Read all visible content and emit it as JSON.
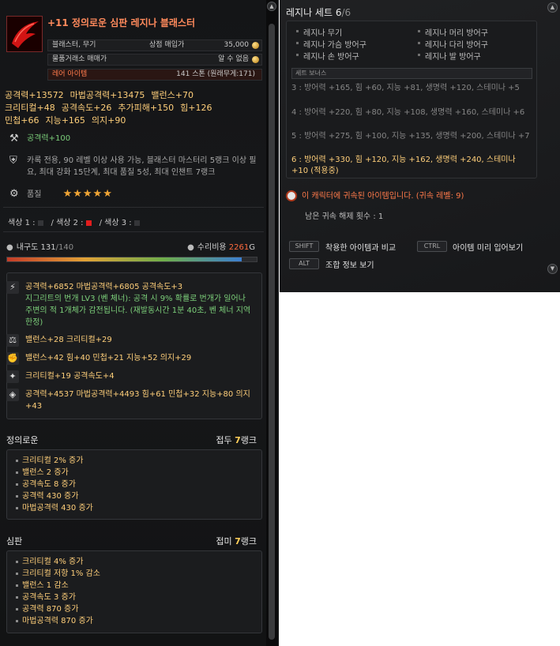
{
  "item": {
    "title": "+11 정의로운 심판 레지나 블래스터",
    "rows": [
      {
        "label": "블래스터, 무기",
        "mid": "상점 매입가",
        "value": "35,000"
      },
      {
        "label": "물품거래소 매매가",
        "mid": "",
        "value": "알 수 없음"
      },
      {
        "label": "레어 아이템",
        "mid": "",
        "value": "141 스톤 (원래무게:171)"
      }
    ]
  },
  "base_stats": {
    "line1": [
      "공격력+13572",
      "마법공격력+13475",
      "밸런스+70"
    ],
    "line2": [
      "크리티컬+48",
      "공격속도+26",
      "추가피해+150",
      "힘+126"
    ],
    "line3": [
      "민첩+66",
      "지능+165",
      "의지+90"
    ]
  },
  "attack_line": "공격력+100",
  "requirement": "카록 전용, 90 레벨 이상 사용 가능, 블래스터 마스터리 5랭크 이상 필요, 최대 강화 15단계, 최대 품질 5성, 최대 인챈트 7랭크",
  "quality": {
    "label": "품질",
    "stars": "★★★★★"
  },
  "colors": {
    "c1": "색상 1 :",
    "c2": "색상 2 :",
    "c3": "색상 3 :",
    "sep": "/"
  },
  "durability": {
    "label": "내구도",
    "current": "131",
    "max": "/140",
    "fraction": 0.94
  },
  "repair": {
    "label": "수리비용",
    "value": "2261",
    "unit": "G"
  },
  "enchants": [
    {
      "icon": "lightning-icon",
      "text": "공격력+6852  마법공격력+6805  공격속도+3"
    },
    {
      "icon": "",
      "text": "지그리트의 번개 LV3 (벤 체너): 공격 시 9% 확률로 번개가 일어나 주변의 적 1개체가 감전됩니다. (재발동시간 1분 40초, 벤 체너 지역 한정)"
    },
    {
      "icon": "balance-icon",
      "text": "밸런스+28  크리티컬+29"
    },
    {
      "icon": "fist-icon",
      "text": "밸런스+42  힘+40  민첩+21  지능+52  의지+29"
    },
    {
      "icon": "crit-icon",
      "text": "크리티컬+19  공격속도+4"
    },
    {
      "icon": "gem-icon",
      "text": "공격력+4537  마법공격력+4493  힘+61  민첩+32  지능+80  의지+43"
    }
  ],
  "section1": {
    "title": "정의로운",
    "rank_prefix": "접두",
    "rank_num": "7",
    "rank_suffix": "랭크",
    "items": [
      "크리티컬 2% 증가",
      "밸런스 2 증가",
      "공격속도 8 증가",
      "공격력 430 증가",
      "마법공격력 430 증가"
    ]
  },
  "section2": {
    "title": "심판",
    "rank_prefix": "접미",
    "rank_num": "7",
    "rank_suffix": "랭크",
    "items": [
      "크리티컬 4% 증가",
      "크리티컬 저항 1% 감소",
      "밸런스 1 감소",
      "공격속도 3 증가",
      "공격력 870 증가",
      "마법공격력 870 증가"
    ]
  },
  "set": {
    "title": "레지나 세트 6",
    "count": "/6",
    "pieces_left": [
      "레지나 무기",
      "레지나 가슴 방어구",
      "레지나 손 방어구"
    ],
    "pieces_right": [
      "레지나 머리 방어구",
      "레지나 다리 방어구",
      "레지나 발 방어구"
    ],
    "bonus_label": "세트 보너스",
    "bonus_3": "3 : 방어력 +165, 힘 +60, 지능 +81, 생명력 +120, 스테미나 +5",
    "bonus_4": "4 : 방어력 +220, 힘 +80, 지능 +108, 생명력 +160, 스테미나 +6",
    "bonus_5": "5 : 방어력 +275, 힘 +100, 지능 +135, 생명력 +200, 스테미나 +7",
    "bonus_6": "6 : 방어력 +330, 힘 +120, 지능 +162, 생명력 +240, 스테미나 +10 (적용중)"
  },
  "bound": {
    "text": "이 캐릭터에 귀속된 아이템입니다. (귀속 레벨: 9)",
    "unbind": "남은 귀속 해제 횟수 : 1"
  },
  "shortcuts": [
    {
      "key": "SHIFT",
      "label": "착용한 아이템과 비교"
    },
    {
      "key": "CTRL",
      "label": "아이템 미리 입어보기"
    },
    {
      "key": "ALT",
      "label": "조합 정보 보기"
    }
  ]
}
